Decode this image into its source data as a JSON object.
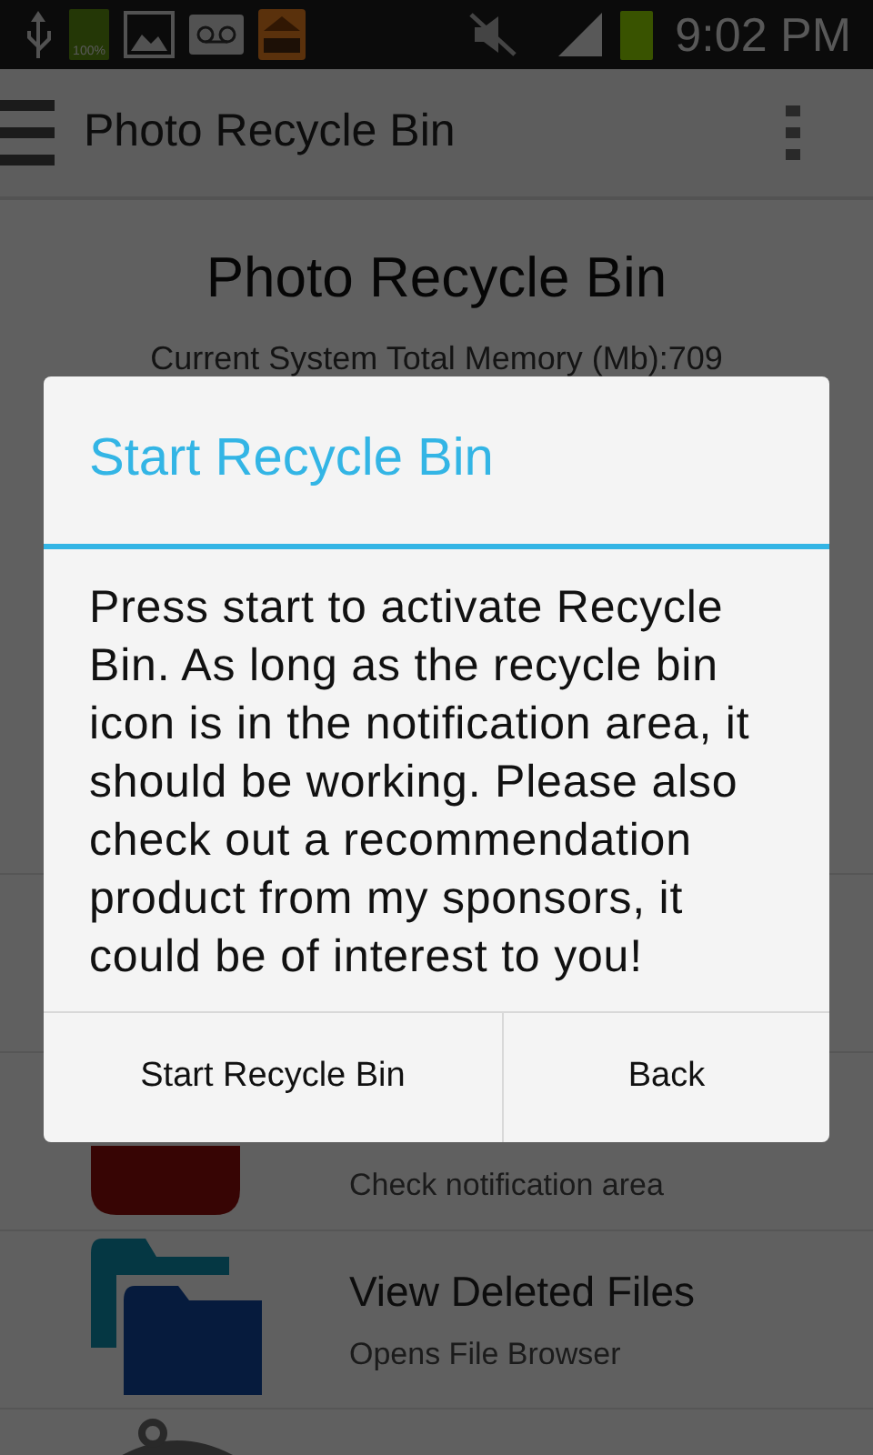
{
  "status_bar": {
    "battery_label": "100%",
    "time": "9:02 PM"
  },
  "app_bar": {
    "title": "Photo Recycle Bin"
  },
  "content": {
    "heading": "Photo Recycle Bin",
    "memory": "Current System Total Memory (Mb):709"
  },
  "list": [
    {
      "kind": "blank"
    },
    {
      "kind": "start",
      "subtitle": "Check notification area"
    },
    {
      "kind": "folder",
      "title": "View Deleted Files",
      "subtitle": "Opens File Browser"
    },
    {
      "kind": "trash"
    }
  ],
  "dialog": {
    "title": "Start Recycle Bin",
    "message": "Press start to activate Recycle Bin. As long as the recycle bin icon is in the notification area, it should be working. Please also check out a recommendation product from my sponsors, it could be of interest to you!",
    "buttons": [
      "Start Recycle Bin",
      "Back"
    ]
  }
}
